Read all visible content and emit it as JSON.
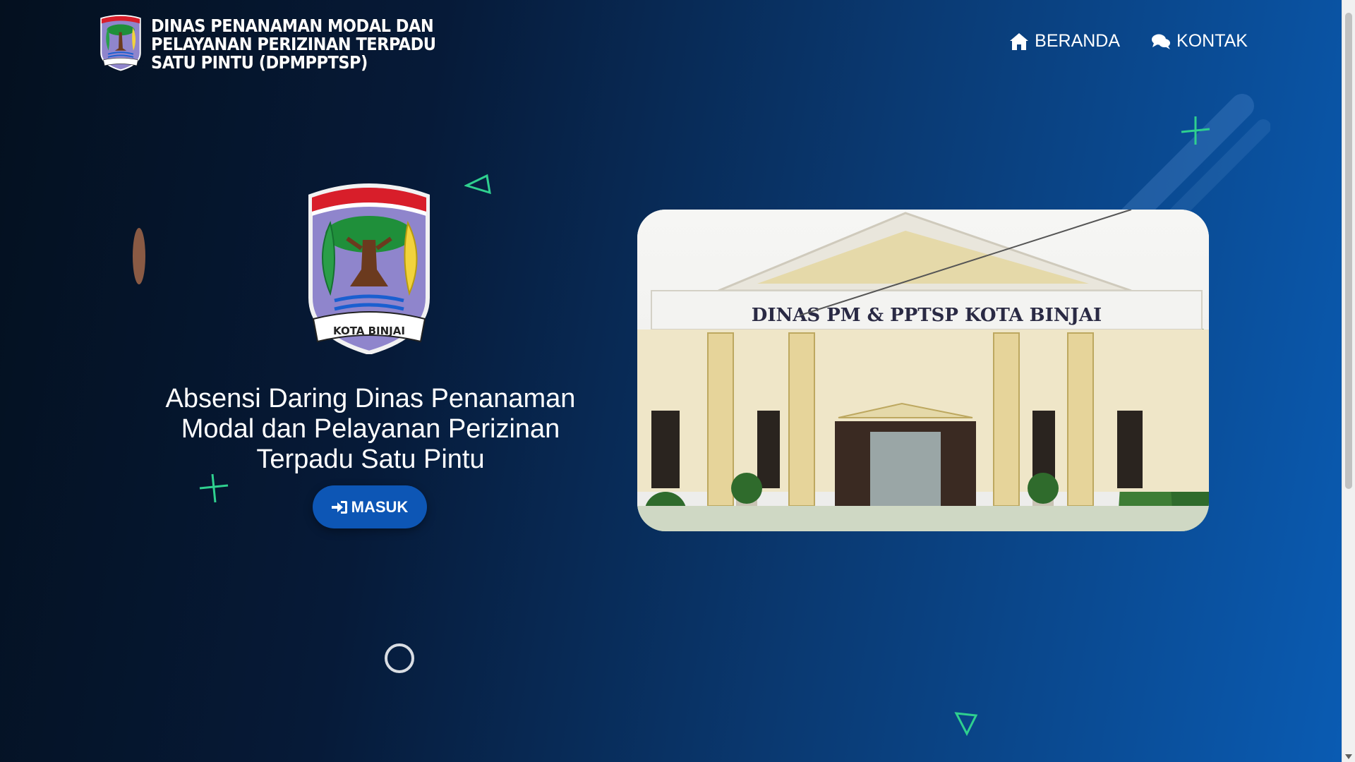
{
  "header": {
    "brand_title": "DINAS PENANAMAN MODAL DAN PELAYANAN PERIZINAN TERPADU SATU PINTU (DPMPPTSP)",
    "brand_logo_icon": "kota-binjai-emblem-icon",
    "nav": [
      {
        "label": "BERANDA",
        "icon": "home-icon"
      },
      {
        "label": "KONTAK",
        "icon": "chat-bubbles-icon"
      }
    ]
  },
  "hero": {
    "logo_text": "KOTA BINJAI",
    "title": "Absensi Daring Dinas Penanaman Modal dan Pelayanan Perizinan Terpadu Satu Pintu",
    "button_label": "MASUK",
    "button_icon": "sign-in-icon",
    "photo_sign": "DINAS PM & PPTSP KOTA BINJAI"
  },
  "colors": {
    "background_start": "#04101f",
    "background_end": "#0a5cb4",
    "button": "#0d56b5",
    "accent_shapes": "#2fd08f"
  }
}
